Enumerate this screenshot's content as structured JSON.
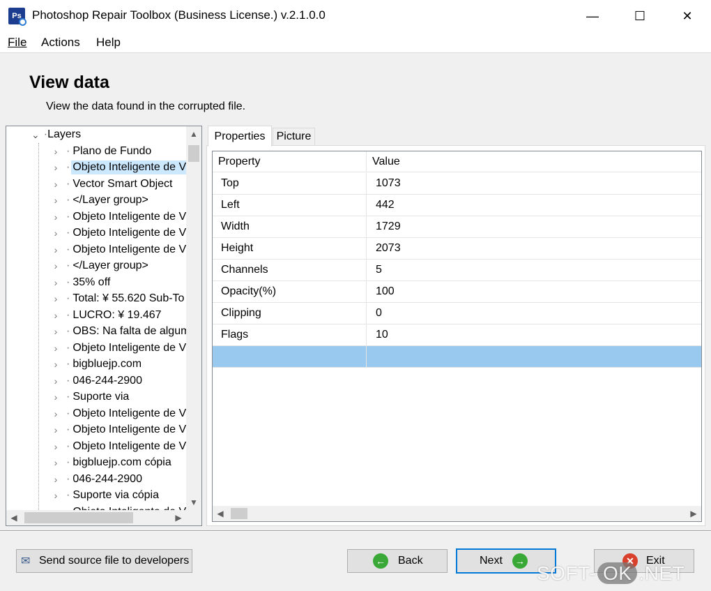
{
  "window": {
    "title": "Photoshop Repair Toolbox (Business License.) v.2.1.0.0",
    "controls": {
      "minimize": "—",
      "maximize": "☐",
      "close": "✕"
    }
  },
  "menu": [
    {
      "label": "File"
    },
    {
      "label": "Actions"
    },
    {
      "label": "Help"
    }
  ],
  "header": {
    "title": "View data",
    "subtitle": "View the data found in the corrupted file."
  },
  "tree": {
    "root": "Layers",
    "items": [
      "Plano de Fundo",
      "Objeto Inteligente de V",
      "Vector Smart Object",
      "</Layer group>",
      "Objeto Inteligente de V",
      "Objeto Inteligente de V",
      "Objeto Inteligente de V",
      "</Layer group>",
      "35% off",
      "Total: ¥ 55.620 Sub-To",
      "LUCRO: ¥ 19.467",
      "OBS: Na falta de algum",
      "Objeto Inteligente de V",
      "bigbluejp.com",
      "046-244-2900",
      "Suporte via",
      "Objeto Inteligente de V",
      "Objeto Inteligente de V",
      "Objeto Inteligente de V",
      "bigbluejp.com cópia",
      "046-244-2900",
      "Suporte via cópia",
      "Objeto Inteligente de V"
    ],
    "selected_index": 1
  },
  "tabs": [
    {
      "label": "Properties",
      "active": true
    },
    {
      "label": "Picture",
      "active": false
    }
  ],
  "grid": {
    "columns": [
      "Property",
      "Value"
    ],
    "rows": [
      {
        "property": "Top",
        "value": "1073"
      },
      {
        "property": "Left",
        "value": "442"
      },
      {
        "property": "Width",
        "value": "1729"
      },
      {
        "property": "Height",
        "value": "2073"
      },
      {
        "property": "Channels",
        "value": "5"
      },
      {
        "property": "Opacity(%)",
        "value": "100"
      },
      {
        "property": "Clipping",
        "value": "0"
      },
      {
        "property": "Flags",
        "value": "10"
      },
      {
        "property": "",
        "value": ""
      }
    ]
  },
  "buttons": {
    "send": "Send source file to developers",
    "back": "Back",
    "next": "Next",
    "exit": "Exit"
  },
  "watermark": {
    "left": "SOFT-",
    "middle": "OK",
    "right": ".NET"
  },
  "colors": {
    "selection_tree": "#cce8ff",
    "selection_grid": "#99c9ef",
    "accent": "#0078d7",
    "back_icon": "#3aa836",
    "next_icon": "#3aa836",
    "exit_icon": "#d9402b"
  }
}
